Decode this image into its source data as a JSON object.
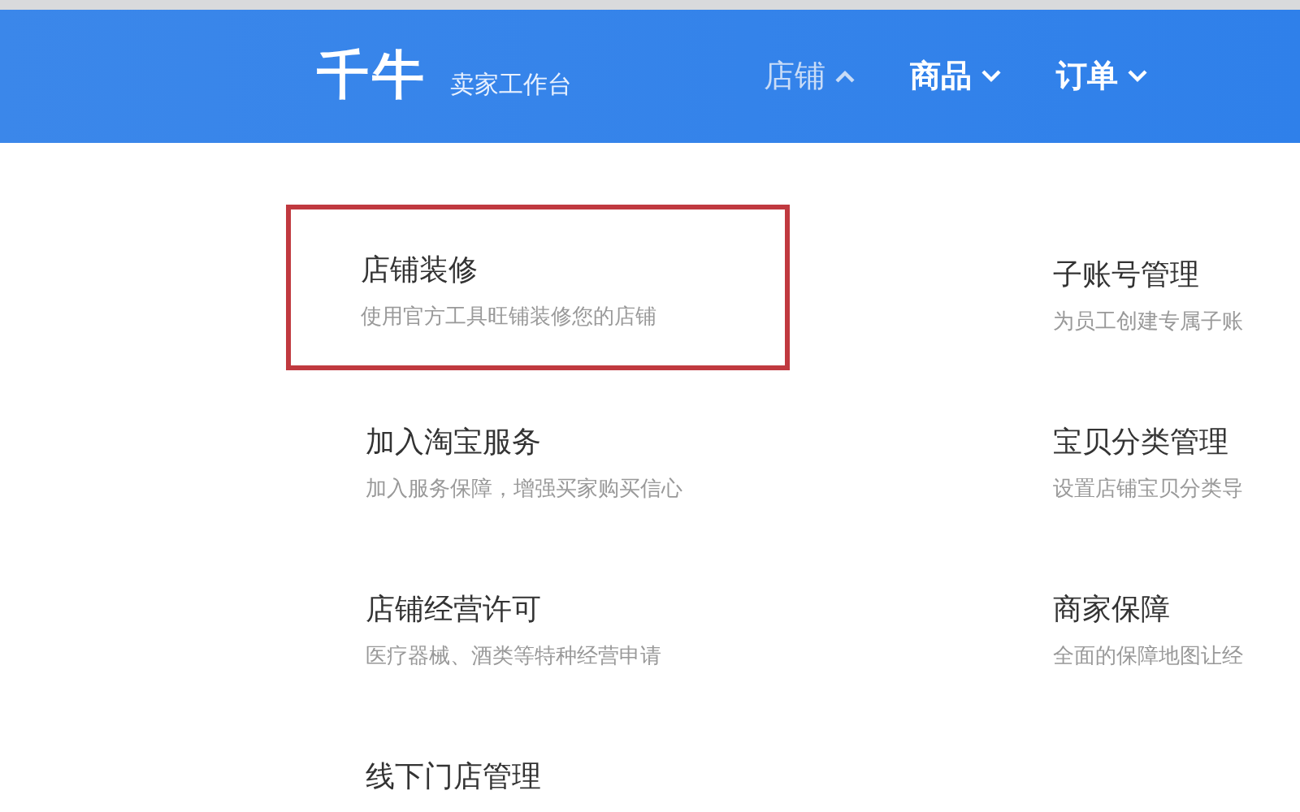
{
  "header": {
    "logo": "千牛",
    "subtitle": "卖家工作台",
    "nav": [
      {
        "label": "店铺",
        "selected": true,
        "expanded": true
      },
      {
        "label": "商品",
        "selected": false,
        "expanded": false
      },
      {
        "label": "订单",
        "selected": false,
        "expanded": false
      }
    ]
  },
  "menu": [
    {
      "title": "店铺装修",
      "description": "使用官方工具旺铺装修您的店铺",
      "highlighted": true
    },
    {
      "title": "子账号管理",
      "description": "为员工创建专属子账",
      "highlighted": false
    },
    {
      "title": "加入淘宝服务",
      "description": "加入服务保障，增强买家购买信心",
      "highlighted": false
    },
    {
      "title": "宝贝分类管理",
      "description": "设置店铺宝贝分类导",
      "highlighted": false
    },
    {
      "title": "店铺经营许可",
      "description": "医疗器械、酒类等特种经营申请",
      "highlighted": false
    },
    {
      "title": "商家保障",
      "description": "全面的保障地图让经",
      "highlighted": false
    },
    {
      "title": "线下门店管理",
      "highlighted": false
    }
  ]
}
